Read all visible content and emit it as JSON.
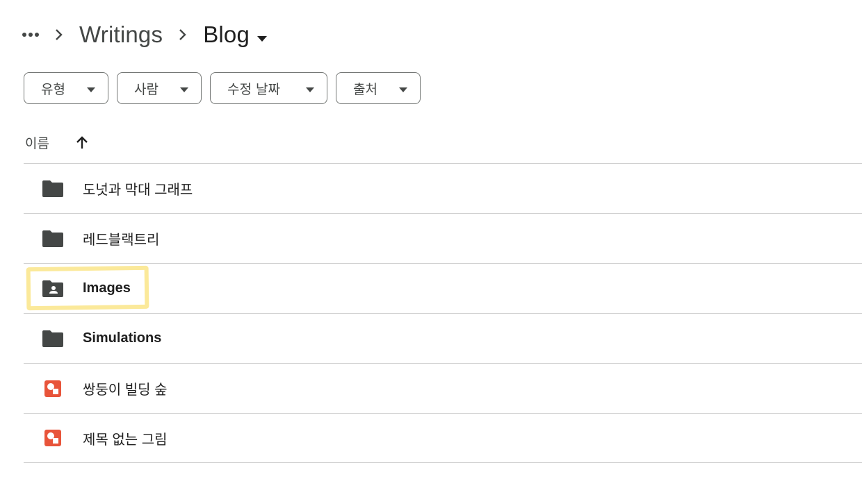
{
  "breadcrumb": {
    "more_icon": "more-horiz-icon",
    "items": [
      "Writings",
      "Blog"
    ]
  },
  "filters": [
    {
      "label": "유형"
    },
    {
      "label": "사람"
    },
    {
      "label": "수정 날짜"
    },
    {
      "label": "출처"
    }
  ],
  "list": {
    "name_header": "이름",
    "sort": "ascending",
    "rows": [
      {
        "name": "도넛과 막대 그래프",
        "type": "folder",
        "icon": "folder-icon"
      },
      {
        "name": "레드블랙트리",
        "type": "folder",
        "icon": "folder-icon"
      },
      {
        "name": "Images",
        "type": "shared-folder",
        "icon": "shared-folder-icon",
        "highlighted": true
      },
      {
        "name": "Simulations",
        "type": "folder",
        "icon": "folder-icon"
      },
      {
        "name": "쌍둥이 빌딩 숲",
        "type": "drawing",
        "icon": "drawing-icon"
      },
      {
        "name": "제목 없는 그림",
        "type": "drawing",
        "icon": "drawing-icon"
      }
    ]
  },
  "colors": {
    "folder": "#444746",
    "drawing": "#e8543a",
    "highlight": "#fbe99a"
  }
}
